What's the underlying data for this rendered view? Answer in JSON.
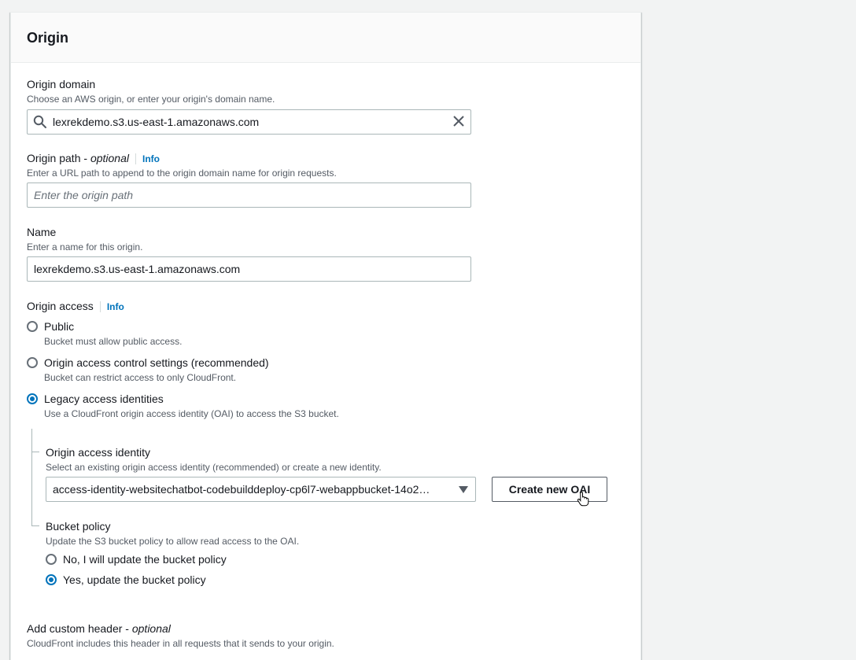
{
  "section": {
    "title": "Origin"
  },
  "origin_domain": {
    "label": "Origin domain",
    "description": "Choose an AWS origin, or enter your origin's domain name.",
    "value": "lexrekdemo.s3.us-east-1.amazonaws.com"
  },
  "origin_path": {
    "label": "Origin path - ",
    "label_optional": "optional",
    "info": "Info",
    "description": "Enter a URL path to append to the origin domain name for origin requests.",
    "placeholder": "Enter the origin path"
  },
  "name": {
    "label": "Name",
    "description": "Enter a name for this origin.",
    "value": "lexrekdemo.s3.us-east-1.amazonaws.com"
  },
  "origin_access": {
    "label": "Origin access",
    "info": "Info",
    "options": [
      {
        "label": "Public",
        "description": "Bucket must allow public access.",
        "selected": false
      },
      {
        "label": "Origin access control settings (recommended)",
        "description": "Bucket can restrict access to only CloudFront.",
        "selected": false
      },
      {
        "label": "Legacy access identities",
        "description": "Use a CloudFront origin access identity (OAI) to access the S3 bucket.",
        "selected": true
      }
    ]
  },
  "oai": {
    "label": "Origin access identity",
    "description": "Select an existing origin access identity (recommended) or create a new identity.",
    "selected_value": "access-identity-websitechatbot-codebuilddeploy-cp6l7-webappbucket-14o2…",
    "create_button": "Create new OAI"
  },
  "bucket_policy": {
    "label": "Bucket policy",
    "description": "Update the S3 bucket policy to allow read access to the OAI.",
    "options": [
      {
        "label": "No, I will update the bucket policy",
        "selected": false
      },
      {
        "label": "Yes, update the bucket policy",
        "selected": true
      }
    ]
  },
  "custom_header": {
    "label": "Add custom header - ",
    "label_optional": "optional",
    "description": "CloudFront includes this header in all requests that it sends to your origin."
  },
  "colors": {
    "accent": "#0073bb",
    "border": "#aab7b8",
    "text": "#16191f",
    "muted": "#545b64"
  }
}
